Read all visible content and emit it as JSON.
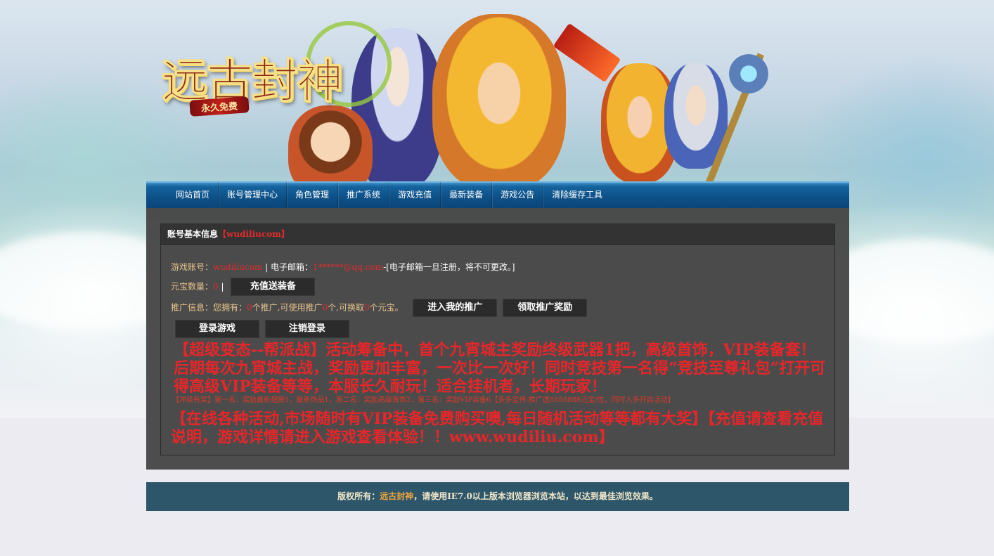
{
  "logo": {
    "title": "远古封神",
    "subtitle": "永久免费"
  },
  "nav": {
    "items": [
      {
        "label": "网站首页"
      },
      {
        "label": "账号管理中心"
      },
      {
        "label": "角色管理"
      },
      {
        "label": "推广系统"
      },
      {
        "label": "游戏充值"
      },
      {
        "label": "最新装备"
      },
      {
        "label": "游戏公告"
      },
      {
        "label": "清除缓存工具"
      }
    ]
  },
  "panel": {
    "title": "账号基本信息",
    "title_account": "【wudiliucom】",
    "account_label": "游戏账号：",
    "account_value": "wudiliucom",
    "email_sep": " | 电子邮箱：",
    "email_value": "1******@qq.com",
    "email_note": "-[电子邮箱一旦注册，将不可更改。]",
    "yuanbao_label": "元宝数量：",
    "yuanbao_value": "0",
    "yuanbao_sep": " | ",
    "recharge_button": "充值送装备",
    "promo_label": "推广信息：您拥有：",
    "promo_count": "0",
    "promo_mid1": "个推广,可使用推广",
    "promo_usable": "0",
    "promo_mid2": "个,可换取",
    "promo_yuanbao": "0",
    "promo_end": "个元宝。",
    "my_promo_button": "进入我的推广",
    "claim_reward_button": "领取推广奖励",
    "login_game_button": "登录游戏",
    "logout_button": "注销登录",
    "announcement_1": "【超级变态--帮派战】活动筹备中，首个九宵城主奖励终级武器1把，高级首饰，VIP装备套！后期每次九宵城主战，奖励更加丰富，一次比一次好！同时竞技第一名得“竞技至尊礼包”打开可得高级VIP装备等等，本服长久耐玩！适合挂机者，长期玩家！",
    "announcement_small": "【冲级有奖】第一名：奖励最新翅膀1，最新饰品1，第二名：奖励高级首饰2，第三名：奖励VIP装备6【多多宣传-推广送8888888元宝/位，同时人多开启活动】",
    "announcement_2": "【在线各种活动,市场随时有VIP装备免费购买噢,每日随机活动等等都有大奖】【充值请查看充值说明，游戏详情请进入游戏查看体验！！www.wudiliu.com】"
  },
  "footer": {
    "prefix": "版权所有：",
    "brand": "远古封神",
    "suffix": "，请使用IE7.0以上版本浏览器浏览本站，以达到最佳浏览效果。"
  },
  "colors": {
    "nav_blue": "#0d4f86",
    "panel_dark": "#464646",
    "highlight_red": "#e22c2c",
    "label_gold": "#e9c48e",
    "footer_teal": "#2d566b",
    "footer_brand": "#f2a53a"
  }
}
